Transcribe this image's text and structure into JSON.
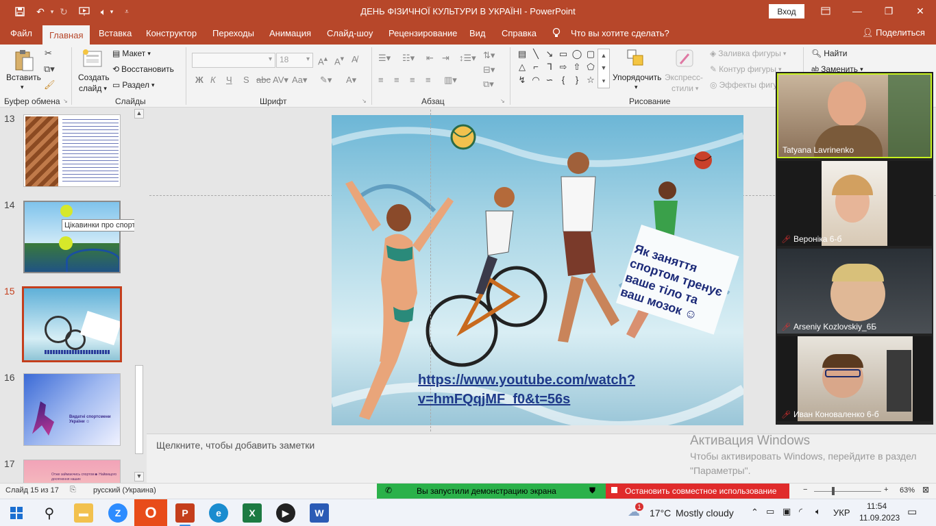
{
  "window": {
    "title": "ДЕНЬ ФІЗИЧНОЇ КУЛЬТУРИ В УКРАЇНІ  -  PowerPoint",
    "signin_label": "Вход"
  },
  "tabs": [
    {
      "label": "Файл"
    },
    {
      "label": "Главная"
    },
    {
      "label": "Вставка"
    },
    {
      "label": "Конструктор"
    },
    {
      "label": "Переходы"
    },
    {
      "label": "Анимация"
    },
    {
      "label": "Слайд-шоу"
    },
    {
      "label": "Рецензирование"
    },
    {
      "label": "Вид"
    },
    {
      "label": "Справка"
    }
  ],
  "tell_me": "Что вы хотите сделать?",
  "share_label": "Поделиться",
  "ribbon": {
    "clipboard": {
      "paste": "Вставить",
      "group": "Буфер обмена"
    },
    "slides": {
      "new_slide_line1": "Создать",
      "new_slide_line2": "слайд",
      "layout": "Макет",
      "reset": "Восстановить",
      "section": "Раздел",
      "group": "Слайды"
    },
    "font": {
      "size": "18",
      "group": "Шрифт"
    },
    "paragraph": {
      "group": "Абзац"
    },
    "drawing": {
      "arrange": "Упорядочить",
      "quick_styles_line1": "Экспресс-",
      "quick_styles_line2": "стили",
      "fill": "Заливка фигуры",
      "outline": "Контур фигуры",
      "effects": "Эффекты фигу",
      "group": "Рисование"
    },
    "editing": {
      "find": "Найти",
      "replace": "Заменить"
    }
  },
  "thumbnails": [
    {
      "num": "13"
    },
    {
      "num": "14"
    },
    {
      "num": "15"
    },
    {
      "num": "16",
      "title": "Видатні спортсмени України ☺"
    },
    {
      "num": "17",
      "title": "Отже займаючись спортом☻ Найвищого досягнення наших"
    }
  ],
  "tooltip": "Цікавинки про спорт",
  "slide": {
    "caption": "Як заняття спортом тренує ваше тіло та ваш мозок ☺",
    "link": "https://www.youtube.com/watch?v=hmFQqjMF_f0&t=56s"
  },
  "notes_placeholder": "Щелкните, чтобы добавить заметки",
  "watermark": {
    "title": "Активация Windows",
    "subtitle": "Чтобы активировать Windows, перейдите в раздел \"Параметры\"."
  },
  "participants": [
    {
      "name": "Tatyana Lavrinenko",
      "muted": false
    },
    {
      "name": "Вероніка 6-б",
      "muted": true
    },
    {
      "name": "Arseniy Kozlovskiy_6Б",
      "muted": true
    },
    {
      "name": "Иван Коноваленко 6-б",
      "muted": true
    }
  ],
  "status": {
    "slide_counter": "Слайд 15 из 17",
    "language": "русский (Украина)",
    "sharing_text": "Вы запустили демонстрацию экрана",
    "stop_sharing": "Остановить совместное использование",
    "zoom_level": "63%"
  },
  "taskbar": {
    "weather_temp": "17°C",
    "weather_desc": "Mostly cloudy",
    "weather_badge": "1",
    "lang": "УКР",
    "time": "11:54",
    "date": "11.09.2023"
  },
  "colors": {
    "accent": "#b7472a",
    "selected": "#c43e1c",
    "zoom_active": "#c8f21e"
  }
}
